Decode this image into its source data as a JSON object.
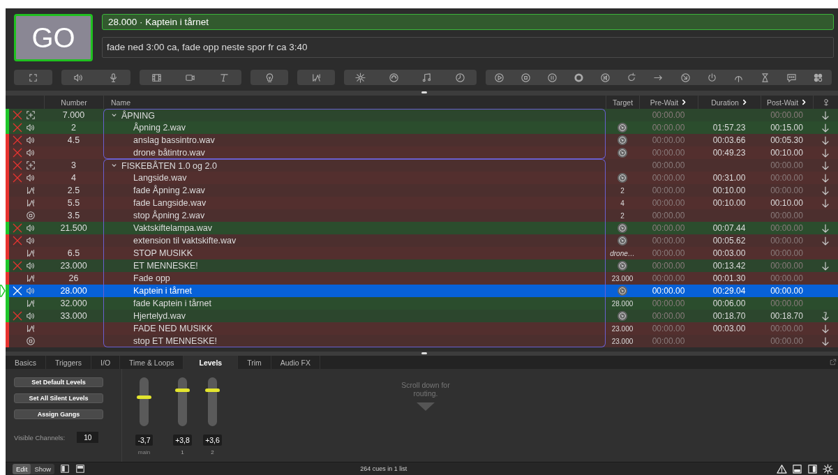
{
  "go_button": {
    "label": "GO"
  },
  "standby": {
    "cue": "28.000 · Kaptein i tårnet",
    "notes": "fade ned 3:00 ca, fade opp neste spor fr ca 3:40"
  },
  "columns": {
    "number": "Number",
    "name": "Name",
    "target": "Target",
    "pre_wait": "Pre-Wait",
    "duration": "Duration",
    "post_wait": "Post-Wait"
  },
  "cues": [
    {
      "kind": "group",
      "number": "7.000",
      "name": "ÅPNING",
      "color": "#1fc72a",
      "broken": true,
      "selected": false,
      "expanded": true,
      "pre_wait": "00:00.00",
      "pre_wait_set": false,
      "post_wait": "00:00.00",
      "post_wait_set": false,
      "auto_continue": true,
      "children": [
        {
          "kind": "audio",
          "number": "2",
          "name": "Åpning 2.wav",
          "color": "#1fc72a",
          "broken": true,
          "selected": false,
          "file_target": true,
          "pre_wait": "00:00.00",
          "pre_wait_set": false,
          "duration": "01:57.23",
          "post_wait": "00:15.00",
          "post_wait_set": true,
          "auto_continue": true
        },
        {
          "kind": "audio",
          "number": "4.5",
          "name": "anslag bassintro.wav",
          "color": "#e8332f",
          "broken": true,
          "selected": false,
          "file_target": true,
          "pre_wait": "00:00.00",
          "pre_wait_set": false,
          "duration": "00:03.66",
          "post_wait": "00:05.30",
          "post_wait_set": true,
          "auto_continue": true
        },
        {
          "kind": "audio",
          "name": "drone båtintro.wav",
          "color": "#e8332f",
          "broken": true,
          "selected": false,
          "file_target": true,
          "pre_wait": "00:00.00",
          "pre_wait_set": false,
          "duration": "00:49.23",
          "post_wait": "00:10.00",
          "post_wait_set": true,
          "auto_continue": true
        }
      ]
    },
    {
      "kind": "group",
      "number": "3",
      "name": "FISKEBÅTEN 1.0 og 2.0",
      "color": "#e8332f",
      "broken": true,
      "selected": false,
      "expanded": true,
      "pre_wait": "00:00.00",
      "pre_wait_set": false,
      "post_wait": "00:00.00",
      "post_wait_set": false,
      "auto_continue": true,
      "children": [
        {
          "kind": "audio",
          "number": "4",
          "name": "Langside.wav",
          "color": "#e8332f",
          "broken": true,
          "selected": false,
          "file_target": true,
          "pre_wait": "00:00.00",
          "pre_wait_set": false,
          "duration": "00:31.00",
          "post_wait": "00:00.00",
          "post_wait_set": false,
          "auto_continue": true
        },
        {
          "kind": "fade",
          "number": "2.5",
          "name": "fade Åpning 2.wav",
          "color": "#e8332f",
          "broken": false,
          "selected": false,
          "target": "2",
          "pre_wait": "00:00.00",
          "pre_wait_set": false,
          "duration": "00:10.00",
          "post_wait": "00:00.00",
          "post_wait_set": false,
          "auto_continue": true
        },
        {
          "kind": "fade",
          "number": "5.5",
          "name": "fade Langside.wav",
          "color": "#e8332f",
          "broken": false,
          "selected": false,
          "target": "4",
          "pre_wait": "00:00.00",
          "pre_wait_set": false,
          "duration": "00:10.00",
          "post_wait": "00:10.00",
          "post_wait_set": true,
          "auto_continue": true
        },
        {
          "kind": "stop",
          "number": "3.5",
          "name": "stop Åpning 2.wav",
          "color": "#e8332f",
          "broken": false,
          "selected": false,
          "target": "2",
          "pre_wait": "00:00.00",
          "pre_wait_set": false,
          "post_wait": "00:00.00",
          "post_wait_set": false,
          "auto_continue": false
        },
        {
          "kind": "audio",
          "number": "21.500",
          "name": "Vaktskiftelampa.wav",
          "color": "#1fc72a",
          "broken": true,
          "selected": false,
          "file_target": true,
          "pre_wait": "00:00.00",
          "pre_wait_set": false,
          "duration": "00:07.44",
          "post_wait": "00:00.00",
          "post_wait_set": false,
          "auto_continue": true
        },
        {
          "kind": "audio",
          "name": "extension til vaktskifte.wav",
          "color": "#e8332f",
          "broken": true,
          "selected": false,
          "file_target": true,
          "pre_wait": "00:00.00",
          "pre_wait_set": false,
          "duration": "00:05.62",
          "post_wait": "00:00.00",
          "post_wait_set": false,
          "auto_continue": true
        },
        {
          "kind": "fade",
          "number": "6.5",
          "name": "STOP MUSIKK",
          "color": "#e8332f",
          "broken": false,
          "selected": false,
          "target": "drone…",
          "pre_wait": "00:00.00",
          "pre_wait_set": false,
          "duration": "00:03.00",
          "post_wait": "00:00.00",
          "post_wait_set": false,
          "auto_continue": false
        },
        {
          "kind": "audio",
          "number": "23.000",
          "name": "ET MENNESKE!",
          "color": "#1fc72a",
          "broken": true,
          "selected": false,
          "file_target": true,
          "pre_wait": "00:00.00",
          "pre_wait_set": false,
          "duration": "00:13.42",
          "post_wait": "00:00.00",
          "post_wait_set": false,
          "auto_continue": true
        },
        {
          "kind": "fade",
          "number": "26",
          "name": "Fade opp",
          "color": "#e8332f",
          "broken": false,
          "selected": false,
          "target": "23.000",
          "pre_wait": "00:00.00",
          "pre_wait_set": false,
          "duration": "00:01.30",
          "post_wait": "00:00.00",
          "post_wait_set": false,
          "auto_continue": false
        },
        {
          "kind": "audio",
          "number": "28.000",
          "name": "Kaptein i tårnet",
          "color": "#1fc72a",
          "broken": true,
          "selected": true,
          "file_target": true,
          "pre_wait": "00:00.00",
          "pre_wait_set": true,
          "duration": "00:29.04",
          "post_wait": "00:00.00",
          "post_wait_set": true,
          "auto_continue": false
        },
        {
          "kind": "fade",
          "number": "32.000",
          "name": "fade Kaptein i tårnet",
          "color": "#1fc72a",
          "broken": false,
          "selected": false,
          "target": "28.000",
          "pre_wait": "00:00.00",
          "pre_wait_set": false,
          "duration": "00:06.00",
          "post_wait": "00:00.00",
          "post_wait_set": false,
          "auto_continue": false
        },
        {
          "kind": "audio",
          "number": "33.000",
          "name": "Hjertelyd.wav",
          "color": "#1fc72a",
          "broken": true,
          "selected": false,
          "file_target": true,
          "pre_wait": "00:00.00",
          "pre_wait_set": false,
          "duration": "00:18.70",
          "post_wait": "00:18.70",
          "post_wait_set": true,
          "auto_continue": false,
          "auto_follow": true
        },
        {
          "kind": "fade",
          "name": "FADE NED MUSIKK",
          "color": "#e8332f",
          "broken": false,
          "selected": false,
          "target": "23.000",
          "pre_wait": "00:00.00",
          "pre_wait_set": false,
          "duration": "00:03.00",
          "post_wait": "00:00.00",
          "post_wait_set": false,
          "auto_continue": true
        },
        {
          "kind": "stop",
          "name": "stop ET MENNESKE!",
          "color": "#e8332f",
          "broken": false,
          "selected": false,
          "target": "23.000",
          "pre_wait": "00:00.00",
          "pre_wait_set": false,
          "post_wait": "00:00.00",
          "post_wait_set": false,
          "auto_continue": true
        }
      ]
    }
  ],
  "inspector_tabs": [
    {
      "label": "Basics",
      "selected": false
    },
    {
      "label": "Triggers",
      "selected": false
    },
    {
      "label": "I/O",
      "selected": false
    },
    {
      "label": "Time & Loops",
      "selected": false
    },
    {
      "label": "Levels",
      "selected": true
    },
    {
      "label": "Trim",
      "selected": false
    },
    {
      "label": "Audio FX",
      "selected": false
    }
  ],
  "level_buttons": [
    "Set Default Levels",
    "Set All Silent Levels",
    "Assign Gangs"
  ],
  "visible_channels": {
    "label": "Visible Channels:",
    "value": "10"
  },
  "faders": [
    {
      "label": "main",
      "reading": "-3,7",
      "level": 0.6
    },
    {
      "label": "1",
      "reading": "+3,8",
      "level": 0.76
    },
    {
      "label": "2",
      "reading": "+3,6",
      "level": 0.76
    }
  ],
  "routing_hint": "Scroll down for routing.",
  "modes": [
    {
      "label": "Edit",
      "selected": true
    },
    {
      "label": "Show",
      "selected": false
    }
  ],
  "status": "264 cues in 1 list"
}
